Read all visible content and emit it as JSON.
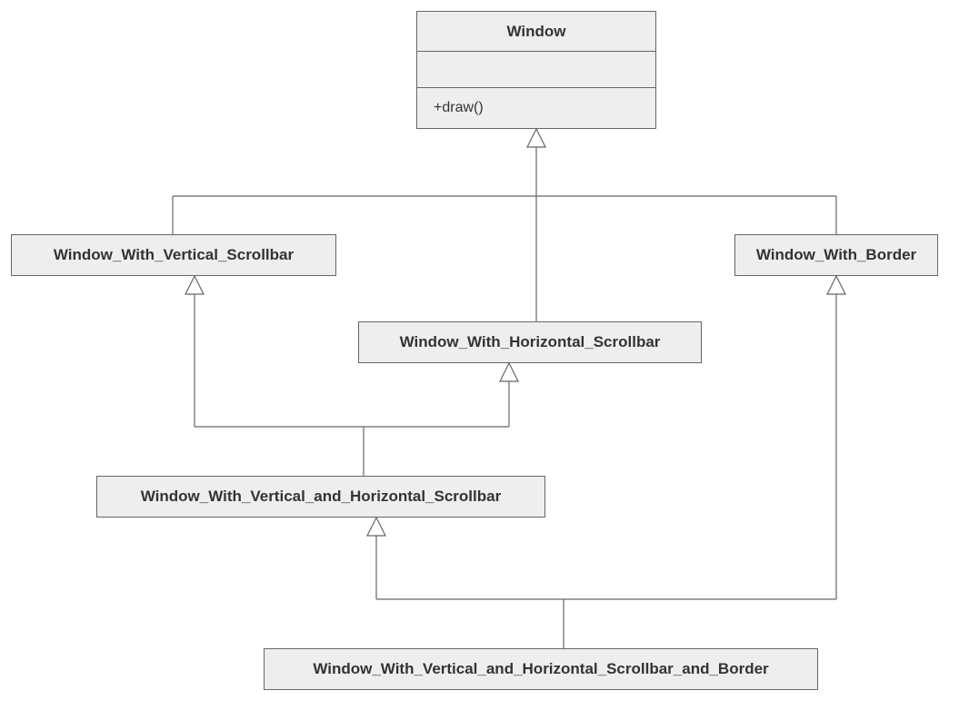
{
  "diagram": {
    "type": "uml-class",
    "classes": {
      "window": {
        "name": "Window",
        "methods": [
          "+draw()"
        ]
      },
      "vscroll": {
        "name": "Window_With_Vertical_Scrollbar"
      },
      "border": {
        "name": "Window_With_Border"
      },
      "hscroll": {
        "name": "Window_With_Horizontal_Scrollbar"
      },
      "vhscroll": {
        "name": "Window_With_Vertical_and_Horizontal_Scrollbar"
      },
      "vhscroll_border": {
        "name": "Window_With_Vertical_and_Horizontal_Scrollbar_and_Border"
      }
    },
    "relations": [
      {
        "from": "vscroll",
        "to": "window",
        "type": "generalization"
      },
      {
        "from": "border",
        "to": "window",
        "type": "generalization"
      },
      {
        "from": "hscroll",
        "to": "window",
        "type": "generalization"
      },
      {
        "from": "vhscroll",
        "to": "vscroll",
        "type": "generalization"
      },
      {
        "from": "vhscroll",
        "to": "hscroll",
        "type": "generalization"
      },
      {
        "from": "vhscroll_border",
        "to": "vhscroll",
        "type": "generalization"
      },
      {
        "from": "vhscroll_border",
        "to": "border",
        "type": "generalization"
      }
    ]
  }
}
